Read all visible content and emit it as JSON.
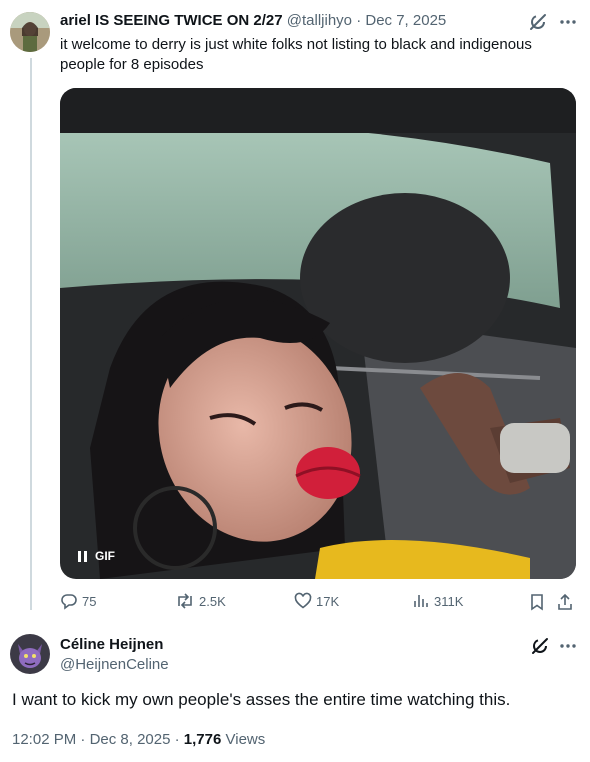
{
  "tweet": {
    "author_name": "ariel IS SEEING TWICE ON 2/27",
    "author_handle": "@talljihyo",
    "separator": "·",
    "date": "Dec 7, 2025",
    "text": "it welcome to derry is just white folks not listing to black and indigenous people for 8 episodes",
    "media": {
      "badge": "GIF"
    },
    "actions": {
      "replies": "75",
      "reposts": "2.5K",
      "likes": "17K",
      "views": "311K"
    }
  },
  "reply": {
    "author_name": "Céline Heijnen",
    "author_handle": "@HeijnenCeline",
    "text": "I want to kick my own people's asses the entire time watching this.",
    "time": "12:02 PM",
    "separator": "·",
    "date": "Dec 8, 2025",
    "dot": "·",
    "views_count": "1,776",
    "views_label": "Views"
  },
  "icons": {
    "grok": "grok-icon",
    "more": "more-icon",
    "reply": "reply-icon",
    "repost": "repost-icon",
    "like": "heart-icon",
    "views": "views-icon",
    "bookmark": "bookmark-icon",
    "share": "share-icon"
  },
  "colors": {
    "text": "#0f1419",
    "muted": "#536471",
    "thread_line": "#cfd9de",
    "link": "#1d9bf0"
  }
}
